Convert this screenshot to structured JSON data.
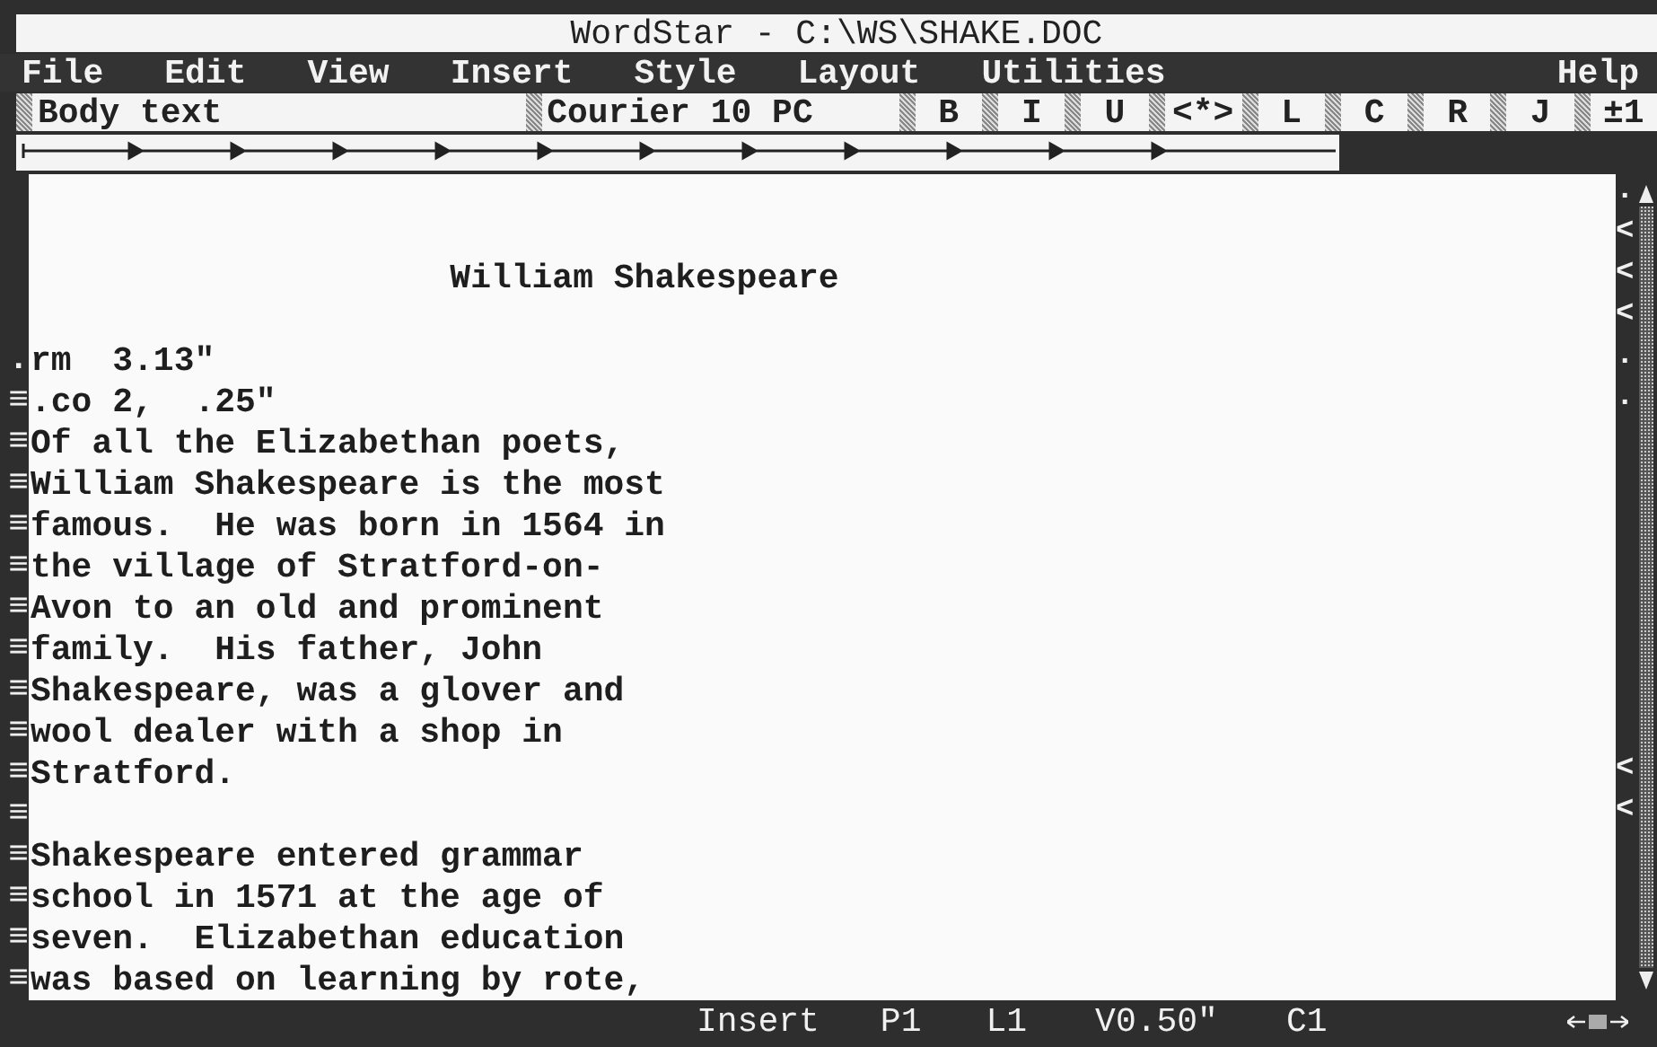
{
  "window": {
    "title": "WordStar - C:\\WS\\SHAKE.DOC"
  },
  "menu": [
    {
      "label": "File"
    },
    {
      "label": "Edit"
    },
    {
      "label": "View"
    },
    {
      "label": "Insert"
    },
    {
      "label": "Style"
    },
    {
      "label": "Layout"
    },
    {
      "label": "Utilities"
    },
    {
      "label": "Help",
      "kind": "right"
    }
  ],
  "style_bar": {
    "style": "Body text",
    "font": "Courier 10 PC",
    "buttons": [
      "B",
      "I",
      "U",
      "<*>",
      "L",
      "C",
      "R",
      "J",
      "±1"
    ]
  },
  "document": {
    "lines": [
      {
        "kind": "blank",
        "marker": "."
      },
      {
        "kind": "blank",
        "marker": "<"
      },
      {
        "kind": "centered",
        "text": "William Shakespeare",
        "marker": "<"
      },
      {
        "kind": "blank",
        "marker": "<"
      },
      {
        "kind": "text",
        "flag": ".",
        "text": "rm  3.13\"",
        "marker": "."
      },
      {
        "kind": "text",
        "flag": "≡",
        "text": ".co 2,  .25\"",
        "marker": "."
      },
      {
        "kind": "text",
        "flag": "≡",
        "text": "Of all the Elizabethan poets,"
      },
      {
        "kind": "text",
        "flag": "≡",
        "text": "William Shakespeare is the most"
      },
      {
        "kind": "text",
        "flag": "≡",
        "text": "famous.  He was born in 1564 in"
      },
      {
        "kind": "text",
        "flag": "≡",
        "text": "the village of Stratford-on-"
      },
      {
        "kind": "text",
        "flag": "≡",
        "text": "Avon to an old and prominent"
      },
      {
        "kind": "text",
        "flag": "≡",
        "text": "family.  His father, John"
      },
      {
        "kind": "text",
        "flag": "≡",
        "text": "Shakespeare, was a glover and"
      },
      {
        "kind": "text",
        "flag": "≡",
        "text": "wool dealer with a shop in"
      },
      {
        "kind": "text",
        "flag": "≡",
        "text": "Stratford.",
        "marker": "<"
      },
      {
        "kind": "blank",
        "flag": "≡",
        "marker": "<"
      },
      {
        "kind": "text",
        "flag": "≡",
        "text": "Shakespeare entered grammar"
      },
      {
        "kind": "text",
        "flag": "≡",
        "text": "school in 1571 at the age of"
      },
      {
        "kind": "text",
        "flag": "≡",
        "text": "seven.  Elizabethan education"
      },
      {
        "kind": "text",
        "flag": "≡",
        "text": "was based on learning by rote,"
      }
    ]
  },
  "status_bar": {
    "mode": "Insert",
    "page": "P1",
    "line": "L1",
    "vertical": "V0.50\"",
    "column": "C1"
  }
}
